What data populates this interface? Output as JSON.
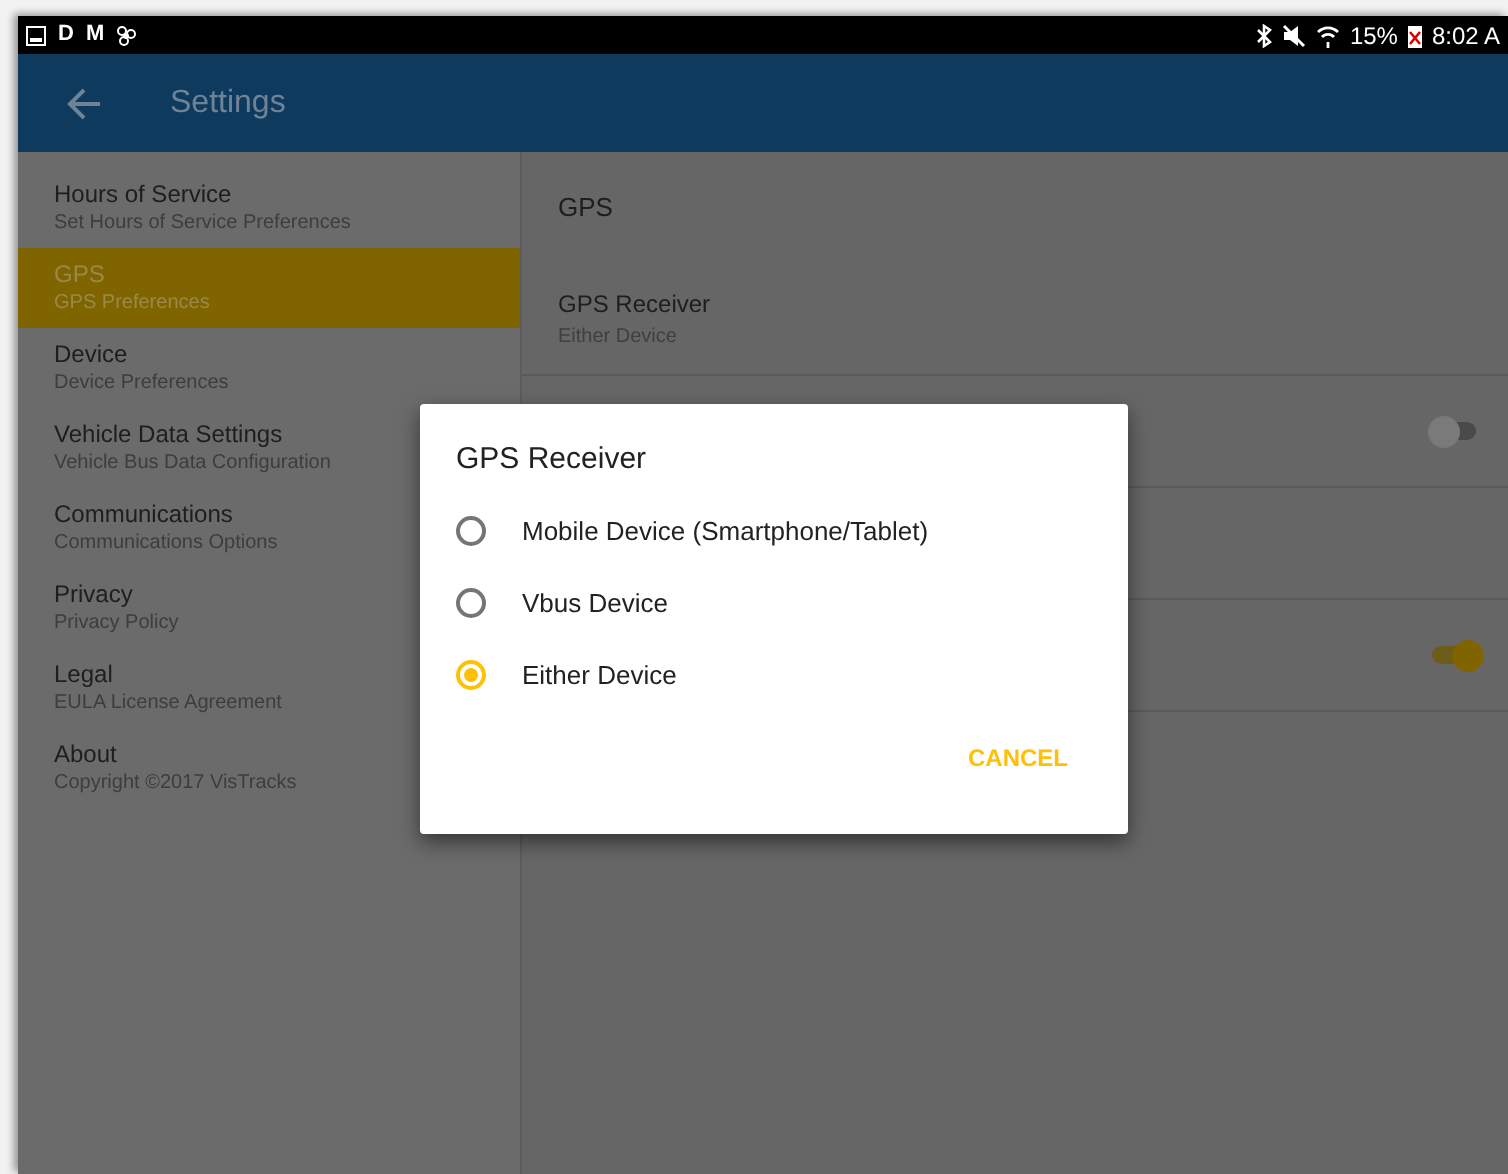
{
  "status_bar": {
    "left_letters": [
      "D",
      "M"
    ],
    "battery": "15%",
    "time": "8:02 A"
  },
  "app_bar": {
    "title": "Settings"
  },
  "sidebar": {
    "items": [
      {
        "title": "Hours of Service",
        "subtitle": "Set Hours of Service Preferences",
        "selected": false
      },
      {
        "title": "GPS",
        "subtitle": "GPS Preferences",
        "selected": true
      },
      {
        "title": "Device",
        "subtitle": "Device Preferences",
        "selected": false
      },
      {
        "title": "Vehicle Data Settings",
        "subtitle": "Vehicle Bus Data Configuration",
        "selected": false
      },
      {
        "title": "Communications",
        "subtitle": "Communications Options",
        "selected": false
      },
      {
        "title": "Privacy",
        "subtitle": "Privacy Policy",
        "selected": false
      },
      {
        "title": "Legal",
        "subtitle": "EULA License Agreement",
        "selected": false
      },
      {
        "title": "About",
        "subtitle": "Copyright ©2017 VisTracks",
        "selected": false
      }
    ]
  },
  "panel": {
    "header": "GPS",
    "rows": [
      {
        "kind": "text",
        "title": "GPS Receiver",
        "subtitle": "Either Device"
      },
      {
        "kind": "switch",
        "on": false
      },
      {
        "kind": "empty"
      },
      {
        "kind": "switch",
        "on": true
      }
    ]
  },
  "dialog": {
    "title": "GPS Receiver",
    "options": [
      {
        "label": "Mobile Device (Smartphone/Tablet)",
        "selected": false
      },
      {
        "label": "Vbus Device",
        "selected": false
      },
      {
        "label": "Either Device",
        "selected": true
      }
    ],
    "button": "CANCEL"
  }
}
